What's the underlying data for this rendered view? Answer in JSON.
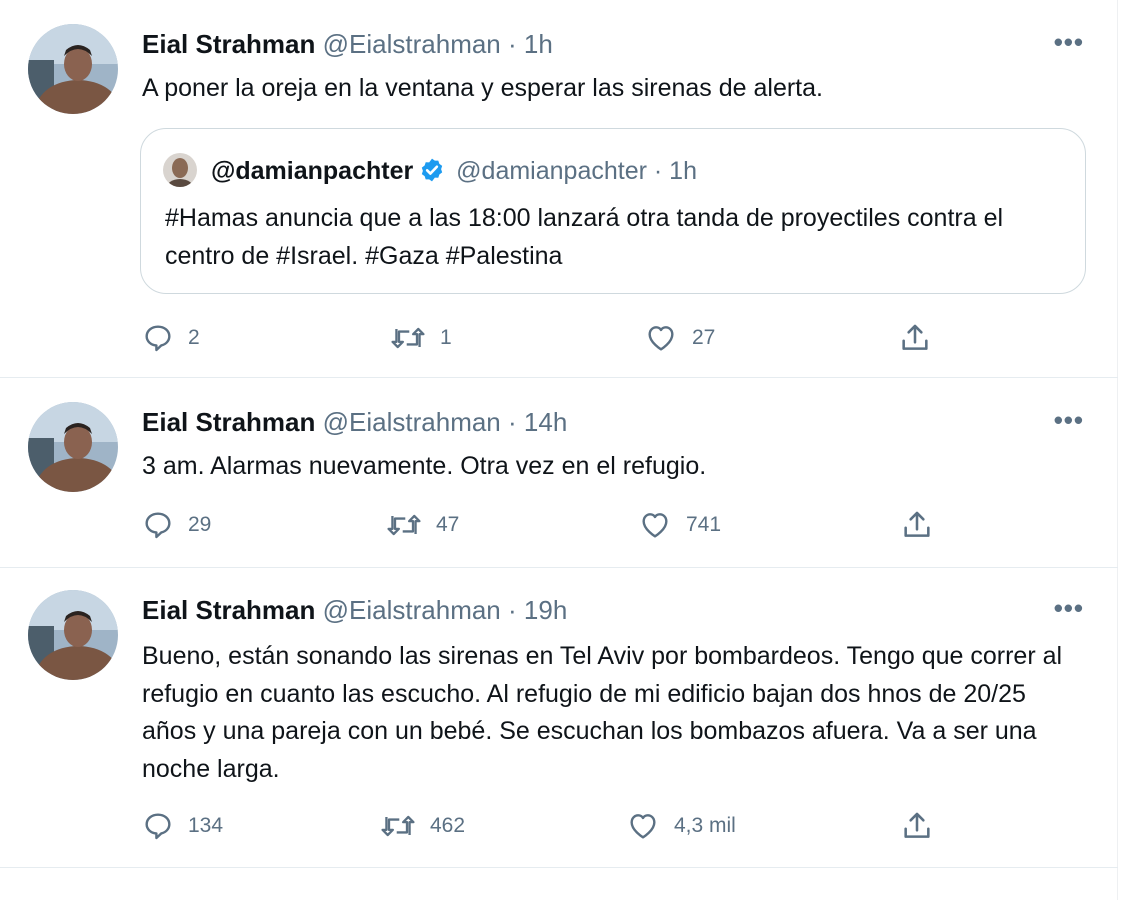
{
  "tweets": [
    {
      "author": "Eial Strahman",
      "handle": "@Eialstrahman",
      "separator": "·",
      "time": "1h",
      "more": "•••",
      "text": "A poner la oreja en la ventana y esperar las sirenas de alerta.",
      "quote": {
        "author": "@damianpachter",
        "verified": true,
        "handle": "@damianpachter",
        "separator": "·",
        "time": "1h",
        "text": "#Hamas anuncia que a las 18:00 lanzará otra tanda de proyectiles contra el centro de #Israel. #Gaza #Palestina"
      },
      "replies": "2",
      "retweets": "1",
      "likes": "27"
    },
    {
      "author": "Eial Strahman",
      "handle": "@Eialstrahman",
      "separator": "·",
      "time": "14h",
      "more": "•••",
      "text": "3 am. Alarmas nuevamente. Otra vez en el refugio.",
      "replies": "29",
      "retweets": "47",
      "likes": "741"
    },
    {
      "author": "Eial Strahman",
      "handle": "@Eialstrahman",
      "separator": "·",
      "time": "19h",
      "more": "•••",
      "text": "Bueno, están sonando las sirenas en Tel Aviv por bombardeos. Tengo que correr al refugio en cuanto las escucho. Al refugio de mi edificio bajan dos hnos de 20/25 años y una pareja con un bebé. Se escuchan los bombazos afuera. Va a ser una noche larga.",
      "replies": "134",
      "retweets": "462",
      "likes": "4,3 mil"
    }
  ],
  "icons": {
    "reply": "reply-icon",
    "retweet": "retweet-icon",
    "like": "heart-icon",
    "share": "share-icon",
    "verified": "verified-badge-icon",
    "more": "more-options-icon"
  },
  "colors": {
    "text": "#0f1419",
    "secondary": "#5b7083",
    "verified": "#1d9bf0",
    "border": "#e6ecf0"
  }
}
